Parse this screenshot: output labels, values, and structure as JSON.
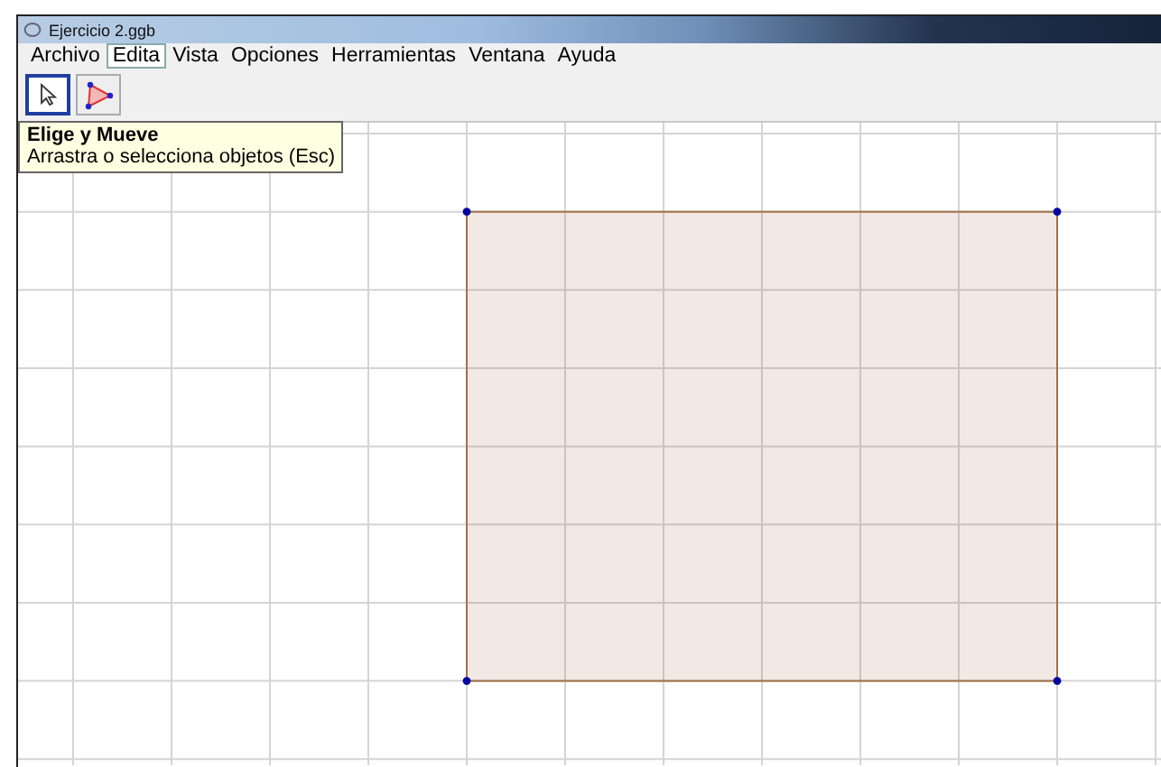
{
  "window": {
    "title": "Ejercicio 2.ggb"
  },
  "menu": [
    {
      "label": "Archivo",
      "selected": false
    },
    {
      "label": "Edita",
      "selected": true
    },
    {
      "label": "Vista",
      "selected": false
    },
    {
      "label": "Opciones",
      "selected": false
    },
    {
      "label": "Herramientas",
      "selected": false
    },
    {
      "label": "Ventana",
      "selected": false
    },
    {
      "label": "Ayuda",
      "selected": false
    }
  ],
  "tools": [
    {
      "kind": "move",
      "selected": true
    },
    {
      "kind": "polygon",
      "selected": false
    }
  ],
  "tooltip": {
    "title": "Elige y Mueve",
    "text": "Arrastra o selecciona objetos (Esc)"
  },
  "graphics": {
    "show_grid": true
  }
}
